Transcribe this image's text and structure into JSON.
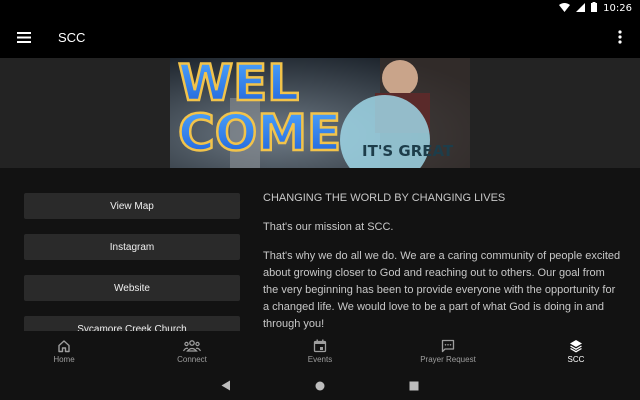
{
  "status_bar": {
    "time": "10:26"
  },
  "app_bar": {
    "title": "SCC"
  },
  "hero": {
    "headline_line1": "WEL",
    "headline_line2": "COME",
    "badge_text": "IT'S GREAT"
  },
  "buttons": [
    {
      "label": "View Map"
    },
    {
      "label": "Instagram"
    },
    {
      "label": "Website"
    },
    {
      "label": "Sycamore Creek Church"
    }
  ],
  "mission": {
    "heading": "CHANGING THE WORLD BY CHANGING LIVES",
    "paragraph1": "That's our mission at SCC.",
    "paragraph2": "That's why we do all we do. We are a caring community of people excited about growing closer to God and reaching out to others. Our goal from the very beginning has been to provide everyone with the opportunity for a changed life. We would love to be a part of what God is doing in and through you!"
  },
  "bottom_nav": [
    {
      "label": "Home",
      "icon": "home-icon"
    },
    {
      "label": "Connect",
      "icon": "people-icon"
    },
    {
      "label": "Events",
      "icon": "calendar-icon"
    },
    {
      "label": "Prayer Request",
      "icon": "chat-icon"
    },
    {
      "label": "SCC",
      "icon": "layers-icon",
      "active": true
    }
  ],
  "colors": {
    "background": "#121212",
    "bar": "#000000",
    "button": "#2a2a2a",
    "active": "#ffffff",
    "inactive": "#9e9e9e"
  }
}
